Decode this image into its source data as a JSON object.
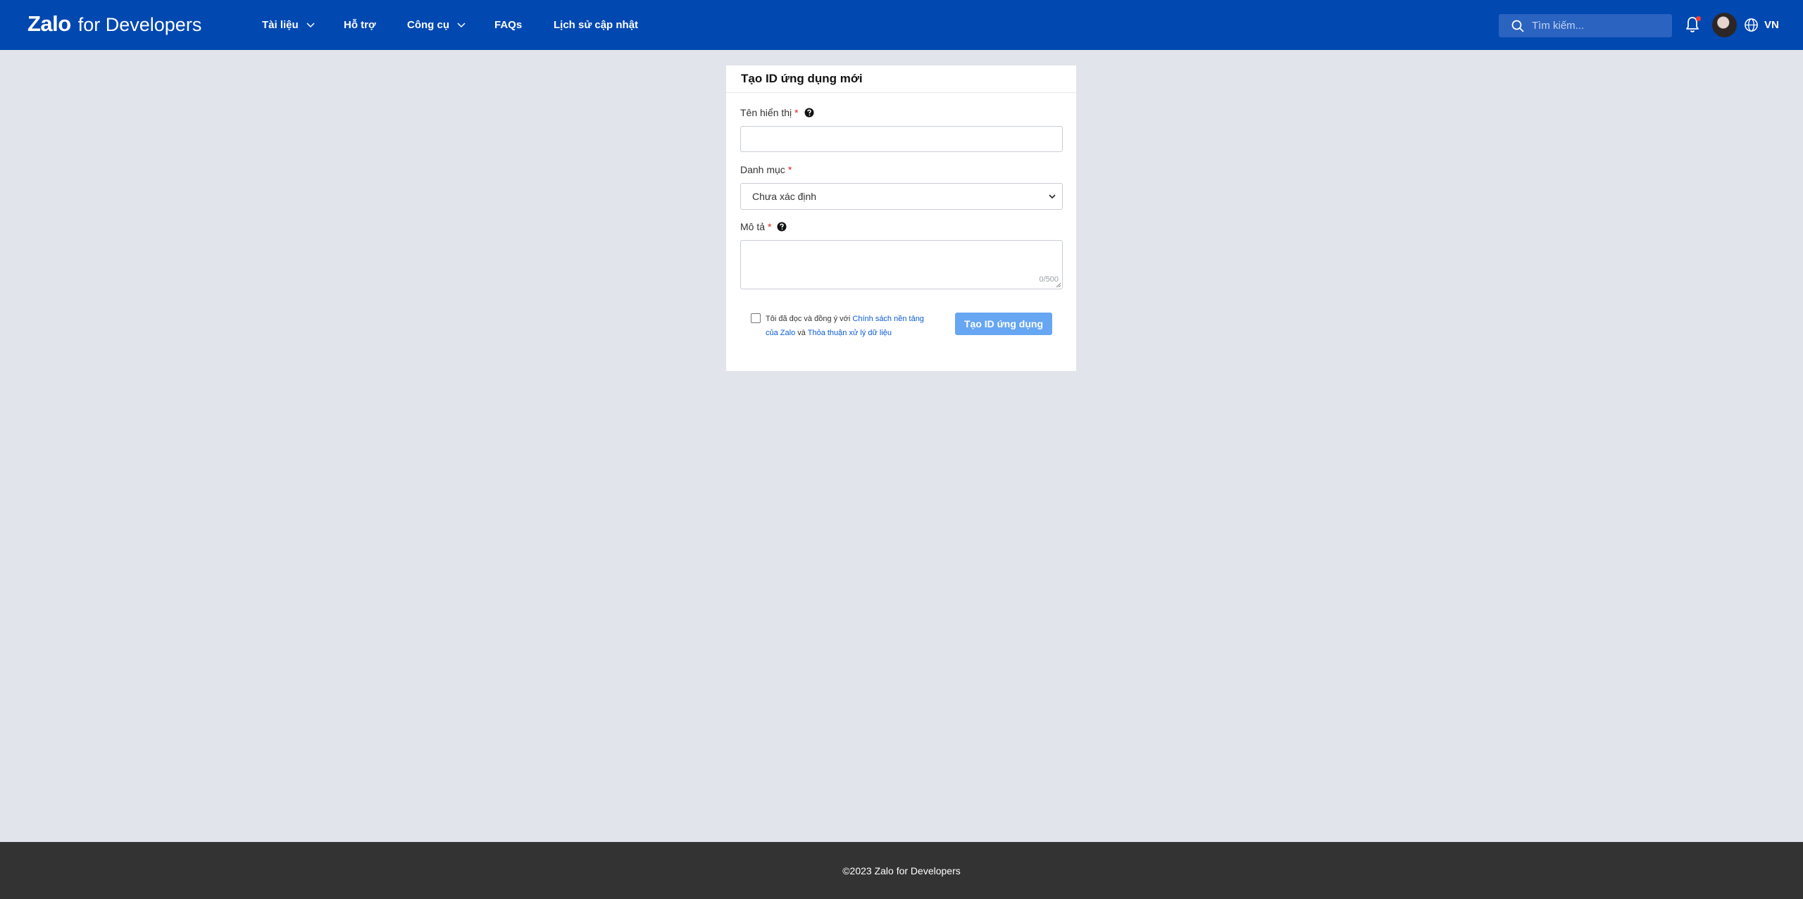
{
  "header": {
    "logo_main": "Zalo",
    "logo_sub": "for Developers",
    "nav": [
      {
        "label": "Tài liệu",
        "has_dropdown": true
      },
      {
        "label": "Hỗ trợ",
        "has_dropdown": false
      },
      {
        "label": "Công cụ",
        "has_dropdown": true
      },
      {
        "label": "FAQs",
        "has_dropdown": false
      },
      {
        "label": "Lịch sử cập nhật",
        "has_dropdown": false
      }
    ],
    "search_placeholder": "Tìm kiếm...",
    "notification_icon": "bell-icon",
    "has_unread_notification": true,
    "language": "VN",
    "colors": {
      "bar": "#0148b1",
      "search_bg": "#2b63c1",
      "badge": "#ff3b30"
    }
  },
  "form": {
    "title": "Tạo ID ứng dụng mới",
    "display_name": {
      "label": "Tên hiển thị",
      "required_mark": "*",
      "value": "",
      "help_icon": "question-circle-icon"
    },
    "category": {
      "label": "Danh mục",
      "required_mark": "*",
      "selected": "Chưa xác định"
    },
    "description": {
      "label": "Mô tả",
      "required_mark": "*",
      "value": "",
      "counter": "0/500",
      "help_icon": "question-circle-icon"
    },
    "agreement": {
      "checked": false,
      "text_before": "Tôi đã đọc và đồng ý với",
      "link_policy": "Chính sách nền tảng của Zalo",
      "text_and": "và",
      "link_data": "Thỏa thuận xử lý dữ liệu"
    },
    "submit_label": "Tạo ID ứng dụng",
    "colors": {
      "submit": "#66a6f2",
      "link": "#0a5bd3",
      "required": "#e02020"
    }
  },
  "footer": {
    "copyright": "©2023 Zalo for Developers"
  }
}
